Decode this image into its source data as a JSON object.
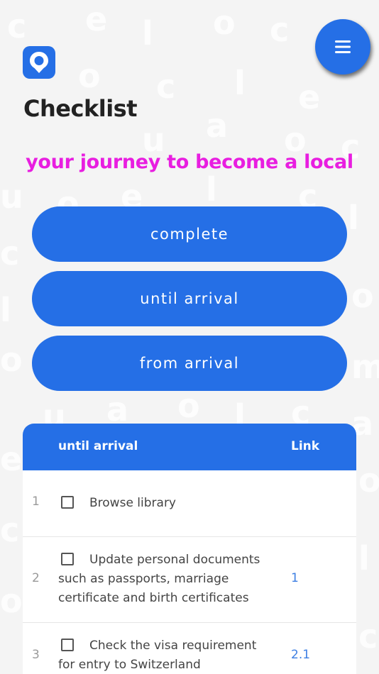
{
  "header": {
    "title": "Checklist",
    "tagline": "your journey to become a local",
    "logo_icon": "map-pin-icon",
    "menu_icon": "hamburger-menu-icon"
  },
  "filters": [
    {
      "label": "complete"
    },
    {
      "label": "until arrival"
    },
    {
      "label": "from arrival"
    }
  ],
  "table": {
    "headers": {
      "task": "until arrival",
      "link": "Link"
    },
    "rows": [
      {
        "num": "1",
        "task": "Browse library",
        "link": ""
      },
      {
        "num": "2",
        "task": "Update personal documents such as passports, marriage certificate and birth certificates",
        "link": "1"
      },
      {
        "num": "3",
        "task": "Check the visa requirement for entry to Switzerland",
        "link": "2.1"
      }
    ]
  },
  "colors": {
    "accent": "#256fe6",
    "tagline": "#e81ee0",
    "title": "#222222",
    "link": "#3d7fe3",
    "background": "#f4f4f4"
  }
}
